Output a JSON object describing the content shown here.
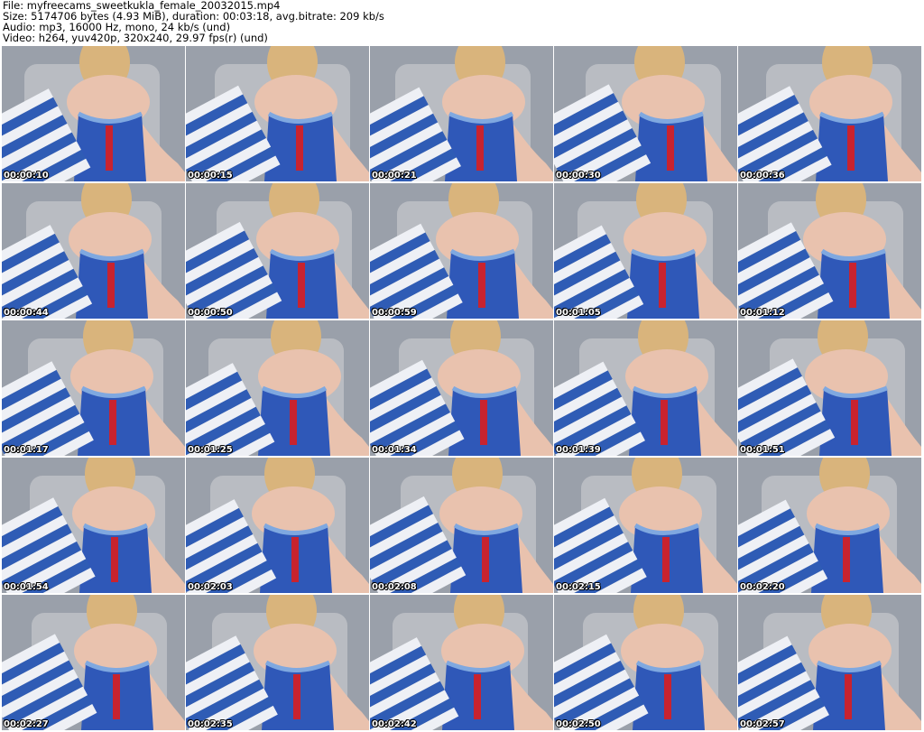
{
  "header": {
    "file_line": "File: myfreecams_sweetkukla_female_20032015.mp4",
    "size_line": "Size: 5174706 bytes (4.93 MiB), duration: 00:03:18, avg.bitrate: 209 kb/s",
    "audio_line": "Audio: mp3, 16000 Hz, mono, 24 kb/s (und)",
    "video_line": "Video: h264, yuv420p, 320x240, 29.97 fps(r) (und)"
  },
  "thumbnails": [
    {
      "timestamp": "00:00:10"
    },
    {
      "timestamp": "00:00:15"
    },
    {
      "timestamp": "00:00:21"
    },
    {
      "timestamp": "00:00:30"
    },
    {
      "timestamp": "00:00:36"
    },
    {
      "timestamp": "00:00:44"
    },
    {
      "timestamp": "00:00:50"
    },
    {
      "timestamp": "00:00:59"
    },
    {
      "timestamp": "00:01:05"
    },
    {
      "timestamp": "00:01:12"
    },
    {
      "timestamp": "00:01:17"
    },
    {
      "timestamp": "00:01:25"
    },
    {
      "timestamp": "00:01:34"
    },
    {
      "timestamp": "00:01:39"
    },
    {
      "timestamp": "00:01:51"
    },
    {
      "timestamp": "00:01:54"
    },
    {
      "timestamp": "00:02:03"
    },
    {
      "timestamp": "00:02:08"
    },
    {
      "timestamp": "00:02:15"
    },
    {
      "timestamp": "00:02:20"
    },
    {
      "timestamp": "00:02:27"
    },
    {
      "timestamp": "00:02:35"
    },
    {
      "timestamp": "00:02:42"
    },
    {
      "timestamp": "00:02:50"
    },
    {
      "timestamp": "00:02:57"
    }
  ],
  "colors": {
    "wall": "#9aa0aa",
    "chair": "#b9bcc2",
    "skin": "#e9c2ae",
    "hair": "#d9b47c",
    "dress_blue": "#2f58b8",
    "lace_blue": "#7fa8e0",
    "ribbon_red": "#c8232f",
    "stripe_white": "#eef0f5",
    "stripe_blue": "#2f5cb5",
    "timestamp_text": "#ffffff"
  }
}
